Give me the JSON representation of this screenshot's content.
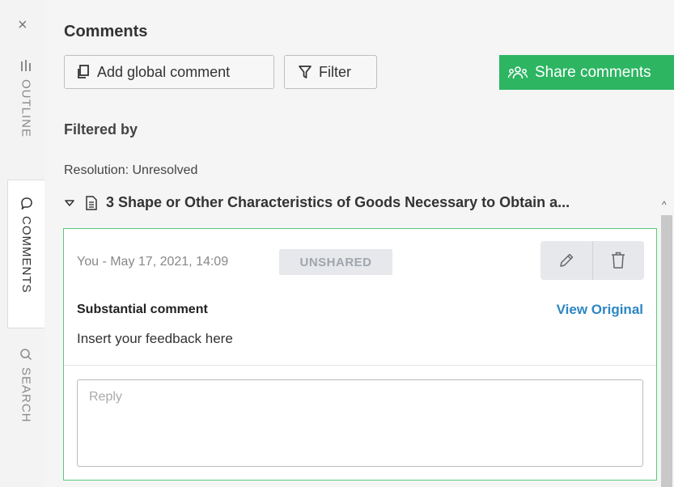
{
  "sidebar": {
    "close_label": "×",
    "tabs": [
      {
        "label": "OUTLINE",
        "icon": "outline-icon"
      },
      {
        "label": "COMMENTS",
        "icon": "comment-bubble-icon"
      },
      {
        "label": "SEARCH",
        "icon": "search-icon"
      }
    ]
  },
  "panel": {
    "title": "Comments",
    "add_global_label": "Add global comment",
    "filter_label": "Filter",
    "share_label": "Share comments",
    "filtered_by_label": "Filtered by",
    "resolution_text": "Resolution: Unresolved",
    "section_title": "3 Shape or Other Characteristics of Goods Necessary to Obtain a...",
    "accent_color": "#2db562"
  },
  "comment": {
    "meta": "You - May 17, 2021, 14:09",
    "badge": "UNSHARED",
    "type": "Substantial comment",
    "view_original": "View Original",
    "text": "Insert your feedback here",
    "reply_placeholder": "Reply"
  }
}
